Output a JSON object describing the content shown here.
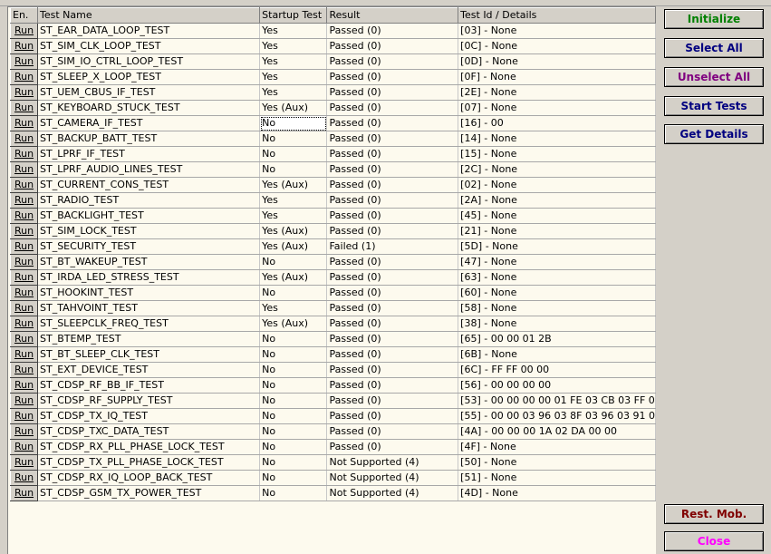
{
  "columns": [
    "En.",
    "Test Name",
    "Startup Test",
    "Result",
    "Test Id / Details"
  ],
  "run_label": "Run",
  "rows": [
    [
      "ST_EAR_DATA_LOOP_TEST",
      "Yes",
      "Passed (0)",
      "[03] - None"
    ],
    [
      "ST_SIM_CLK_LOOP_TEST",
      "Yes",
      "Passed (0)",
      "[0C] - None"
    ],
    [
      "ST_SIM_IO_CTRL_LOOP_TEST",
      "Yes",
      "Passed (0)",
      "[0D] - None"
    ],
    [
      "ST_SLEEP_X_LOOP_TEST",
      "Yes",
      "Passed (0)",
      "[0F] - None"
    ],
    [
      "ST_UEM_CBUS_IF_TEST",
      "Yes",
      "Passed (0)",
      "[2E] - None"
    ],
    [
      "ST_KEYBOARD_STUCK_TEST",
      "Yes (Aux)",
      "Passed (0)",
      "[07] - None"
    ],
    [
      "ST_CAMERA_IF_TEST",
      "No",
      "Passed (0)",
      "[16] - 00"
    ],
    [
      "ST_BACKUP_BATT_TEST",
      "No",
      "Passed (0)",
      "[14] - None"
    ],
    [
      "ST_LPRF_IF_TEST",
      "No",
      "Passed (0)",
      "[15] - None"
    ],
    [
      "ST_LPRF_AUDIO_LINES_TEST",
      "No",
      "Passed (0)",
      "[2C] - None"
    ],
    [
      "ST_CURRENT_CONS_TEST",
      "Yes (Aux)",
      "Passed (0)",
      "[02] - None"
    ],
    [
      "ST_RADIO_TEST",
      "Yes",
      "Passed (0)",
      "[2A] - None"
    ],
    [
      "ST_BACKLIGHT_TEST",
      "Yes",
      "Passed (0)",
      "[45] - None"
    ],
    [
      "ST_SIM_LOCK_TEST",
      "Yes (Aux)",
      "Passed (0)",
      "[21] - None"
    ],
    [
      "ST_SECURITY_TEST",
      "Yes (Aux)",
      "Failed (1)",
      "[5D] - None"
    ],
    [
      "ST_BT_WAKEUP_TEST",
      "No",
      "Passed (0)",
      "[47] - None"
    ],
    [
      "ST_IRDA_LED_STRESS_TEST",
      "Yes (Aux)",
      "Passed (0)",
      "[63] - None"
    ],
    [
      "ST_HOOKINT_TEST",
      "No",
      "Passed (0)",
      "[60] - None"
    ],
    [
      "ST_TAHVOINT_TEST",
      "Yes",
      "Passed (0)",
      "[58] - None"
    ],
    [
      "ST_SLEEPCLK_FREQ_TEST",
      "Yes (Aux)",
      "Passed (0)",
      "[38] - None"
    ],
    [
      "ST_BTEMP_TEST",
      "No",
      "Passed (0)",
      "[65] - 00 00 01 2B"
    ],
    [
      "ST_BT_SLEEP_CLK_TEST",
      "No",
      "Passed (0)",
      "[6B] - None"
    ],
    [
      "ST_EXT_DEVICE_TEST",
      "No",
      "Passed (0)",
      "[6C] - FF FF 00 00"
    ],
    [
      "ST_CDSP_RF_BB_IF_TEST",
      "No",
      "Passed (0)",
      "[56] - 00 00 00 00"
    ],
    [
      "ST_CDSP_RF_SUPPLY_TEST",
      "No",
      "Passed (0)",
      "[53] - 00 00 00 00 01 FE 03 CB 03 FF 0"
    ],
    [
      "ST_CDSP_TX_IQ_TEST",
      "No",
      "Passed (0)",
      "[55] - 00 00 03 96 03 8F 03 96 03 91 0"
    ],
    [
      "ST_CDSP_TXC_DATA_TEST",
      "No",
      "Passed (0)",
      "[4A] - 00 00 00 1A 02 DA 00 00"
    ],
    [
      "ST_CDSP_RX_PLL_PHASE_LOCK_TEST",
      "No",
      "Passed (0)",
      "[4F] - None"
    ],
    [
      "ST_CDSP_TX_PLL_PHASE_LOCK_TEST",
      "No",
      "Not Supported (4)",
      "[50] - None"
    ],
    [
      "ST_CDSP_RX_IQ_LOOP_BACK_TEST",
      "No",
      "Not Supported (4)",
      "[51] - None"
    ],
    [
      "ST_CDSP_GSM_TX_POWER_TEST",
      "No",
      "Not Supported (4)",
      "[4D] - None"
    ]
  ],
  "buttons": {
    "initialize": "Initialize",
    "select_all": "Select All",
    "unselect_all": "Unselect All",
    "start_tests": "Start Tests",
    "get_details": "Get Details",
    "rest_mob": "Rest. Mob.",
    "close": "Close"
  },
  "colors": {
    "initialize": "#008000",
    "select_all": "#000080",
    "unselect_all": "#800080",
    "start_tests": "#000080",
    "get_details": "#000080",
    "rest_mob": "#800000",
    "close": "#ff00ff"
  },
  "selected_cell": {
    "row": 6,
    "column": "startup"
  }
}
